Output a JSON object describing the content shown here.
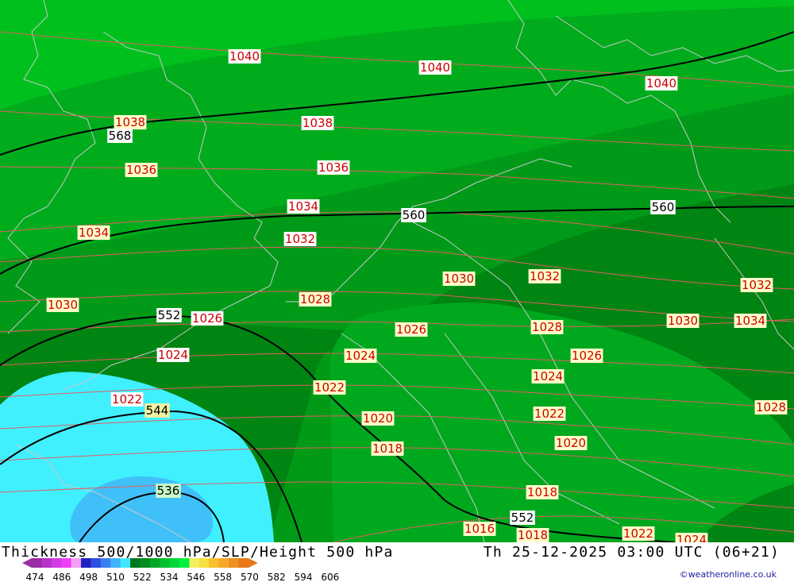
{
  "title": "Thickness 500/1000 hPa/SLP/Height 500 hPa",
  "datetime": "Th 25-12-2025 03:00 UTC (06+21)",
  "credit": "©weatheronline.co.uk",
  "colors": {
    "slp_isobar": "#e06060",
    "height_contour": "#000000",
    "coast_border": "#c8c8c8",
    "label_bg": "#ffffcc",
    "label_text": "#cc0000"
  },
  "slp_labels": [
    "1040",
    "1040",
    "1040",
    "1038",
    "1038",
    "1036",
    "1036",
    "1034",
    "1034",
    "1032",
    "1032",
    "1034",
    "1032",
    "1030",
    "1030",
    "1030",
    "1028",
    "1028",
    "1028",
    "1026",
    "1026",
    "1026",
    "1024",
    "1024",
    "1024",
    "1022",
    "1022",
    "1022",
    "1020",
    "1020",
    "1018",
    "1018",
    "1016",
    "1018",
    "1022",
    "1024"
  ],
  "height_labels": [
    "568",
    "560",
    "560",
    "552",
    "544",
    "536",
    "552"
  ],
  "legend": {
    "ticks": [
      "474",
      "486",
      "498",
      "510",
      "522",
      "534",
      "546",
      "558",
      "570",
      "582",
      "594",
      "606"
    ],
    "colors": [
      "#9a2ca6",
      "#b832c8",
      "#d23ce6",
      "#f040f8",
      "#f4a0f4",
      "#2020c0",
      "#2c50e0",
      "#3c80f0",
      "#40b4f8",
      "#40e8ff",
      "#00781c",
      "#008c20",
      "#00a828",
      "#00c030",
      "#00d838",
      "#00f040",
      "#f0f060",
      "#f8e040",
      "#f8c030",
      "#f8a828",
      "#f09020",
      "#e87818"
    ]
  }
}
